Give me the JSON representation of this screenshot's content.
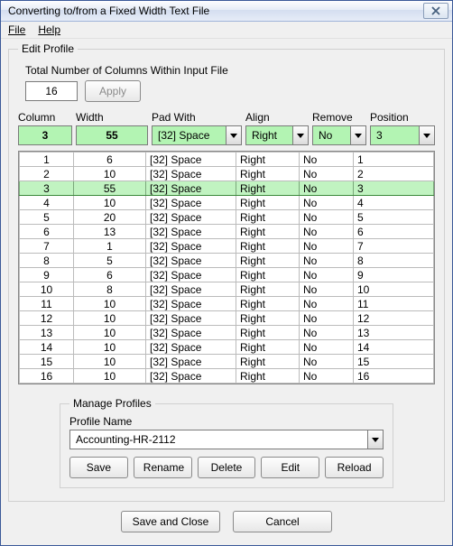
{
  "window": {
    "title": "Converting to/from a Fixed Width Text File"
  },
  "menu": {
    "file": "File",
    "help": "Help"
  },
  "editProfile": {
    "legend": "Edit Profile",
    "totalLabel": "Total Number of Columns Within Input File",
    "totalValue": "16",
    "apply": "Apply"
  },
  "headers": {
    "column": "Column",
    "width": "Width",
    "padWith": "Pad With",
    "align": "Align",
    "remove": "Remove",
    "position": "Position"
  },
  "current": {
    "column": "3",
    "width": "55",
    "padWith": "[32] Space",
    "align": "Right",
    "remove": "No",
    "position": "3"
  },
  "rows": [
    {
      "col": "1",
      "width": "6",
      "pad": "[32] Space",
      "align": "Right",
      "remove": "No",
      "pos": "1",
      "sel": false
    },
    {
      "col": "2",
      "width": "10",
      "pad": "[32] Space",
      "align": "Right",
      "remove": "No",
      "pos": "2",
      "sel": false
    },
    {
      "col": "3",
      "width": "55",
      "pad": "[32] Space",
      "align": "Right",
      "remove": "No",
      "pos": "3",
      "sel": true
    },
    {
      "col": "4",
      "width": "10",
      "pad": "[32] Space",
      "align": "Right",
      "remove": "No",
      "pos": "4",
      "sel": false
    },
    {
      "col": "5",
      "width": "20",
      "pad": "[32] Space",
      "align": "Right",
      "remove": "No",
      "pos": "5",
      "sel": false
    },
    {
      "col": "6",
      "width": "13",
      "pad": "[32] Space",
      "align": "Right",
      "remove": "No",
      "pos": "6",
      "sel": false
    },
    {
      "col": "7",
      "width": "1",
      "pad": "[32] Space",
      "align": "Right",
      "remove": "No",
      "pos": "7",
      "sel": false
    },
    {
      "col": "8",
      "width": "5",
      "pad": "[32] Space",
      "align": "Right",
      "remove": "No",
      "pos": "8",
      "sel": false
    },
    {
      "col": "9",
      "width": "6",
      "pad": "[32] Space",
      "align": "Right",
      "remove": "No",
      "pos": "9",
      "sel": false
    },
    {
      "col": "10",
      "width": "8",
      "pad": "[32] Space",
      "align": "Right",
      "remove": "No",
      "pos": "10",
      "sel": false
    },
    {
      "col": "11",
      "width": "10",
      "pad": "[32] Space",
      "align": "Right",
      "remove": "No",
      "pos": "11",
      "sel": false
    },
    {
      "col": "12",
      "width": "10",
      "pad": "[32] Space",
      "align": "Right",
      "remove": "No",
      "pos": "12",
      "sel": false
    },
    {
      "col": "13",
      "width": "10",
      "pad": "[32] Space",
      "align": "Right",
      "remove": "No",
      "pos": "13",
      "sel": false
    },
    {
      "col": "14",
      "width": "10",
      "pad": "[32] Space",
      "align": "Right",
      "remove": "No",
      "pos": "14",
      "sel": false
    },
    {
      "col": "15",
      "width": "10",
      "pad": "[32] Space",
      "align": "Right",
      "remove": "No",
      "pos": "15",
      "sel": false
    },
    {
      "col": "16",
      "width": "10",
      "pad": "[32] Space",
      "align": "Right",
      "remove": "No",
      "pos": "16",
      "sel": false
    }
  ],
  "manage": {
    "legend": "Manage Profiles",
    "profileLabel": "Profile Name",
    "profileValue": "Accounting-HR-2112",
    "save": "Save",
    "rename": "Rename",
    "delete": "Delete",
    "edit": "Edit",
    "reload": "Reload"
  },
  "bottom": {
    "saveClose": "Save and Close",
    "cancel": "Cancel"
  }
}
